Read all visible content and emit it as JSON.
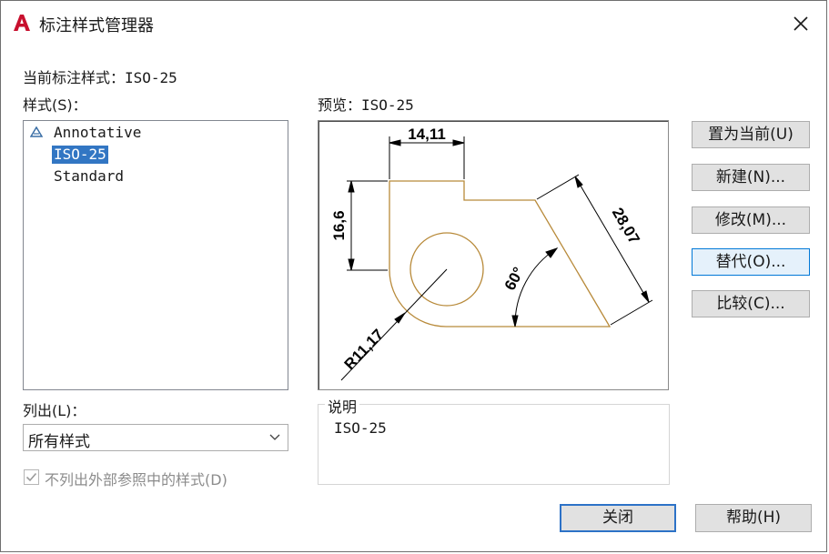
{
  "window": {
    "title": "标注样式管理器"
  },
  "current_style": {
    "label": "当前标注样式：",
    "value": "ISO-25"
  },
  "styles_list": {
    "label": "样式(S)：",
    "items": [
      "Annotative",
      "ISO-25",
      "Standard"
    ],
    "selected": "ISO-25"
  },
  "list_filter": {
    "label": "列出(L)：",
    "value": "所有样式"
  },
  "checkbox": {
    "label": "不列出外部参照中的样式(D)",
    "checked": true,
    "enabled": false
  },
  "preview": {
    "label": "预览：",
    "style": "ISO-25",
    "dimensions": {
      "horizontal": "14,11",
      "vertical": "16,6",
      "aligned": "28,07",
      "angle": "60°",
      "radius": "R11,17"
    }
  },
  "description": {
    "title": "说明",
    "text": "ISO-25"
  },
  "buttons": {
    "set_current": "置为当前(U)",
    "new": "新建(N)...",
    "modify": "修改(M)...",
    "override": "替代(O)...",
    "compare": "比较(C)...",
    "close": "关闭",
    "help": "帮助(H)"
  },
  "colors": {
    "accent": "#3276c3",
    "geometry": "#b88a3a",
    "app_icon": "#c8102e"
  }
}
